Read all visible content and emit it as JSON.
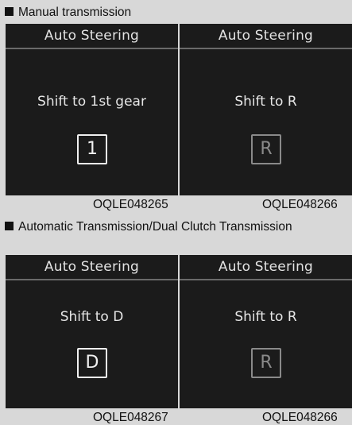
{
  "sections": [
    {
      "heading": "Manual transmission",
      "panels": [
        {
          "title": "Auto Steering",
          "message": "Shift to 1st gear",
          "gear": "1",
          "gear_dimmed": false,
          "code": "OQLE048265"
        },
        {
          "title": "Auto Steering",
          "message": "Shift to R",
          "gear": "R",
          "gear_dimmed": true,
          "code": "OQLE048266"
        }
      ]
    },
    {
      "heading": "Automatic Transmission/Dual Clutch Transmission",
      "panels": [
        {
          "title": "Auto Steering",
          "message": "Shift to D",
          "gear": "D",
          "gear_dimmed": false,
          "code": "OQLE048267"
        },
        {
          "title": "Auto Steering",
          "message": "Shift to R",
          "gear": "R",
          "gear_dimmed": true,
          "code": "OQLE048266"
        }
      ]
    }
  ],
  "colors": {
    "page_background": "#d8d8d8",
    "panel_background": "#1b1b1b",
    "active_gear": "#f0f0f0",
    "dimmed_gear": "#8a8a8a"
  }
}
